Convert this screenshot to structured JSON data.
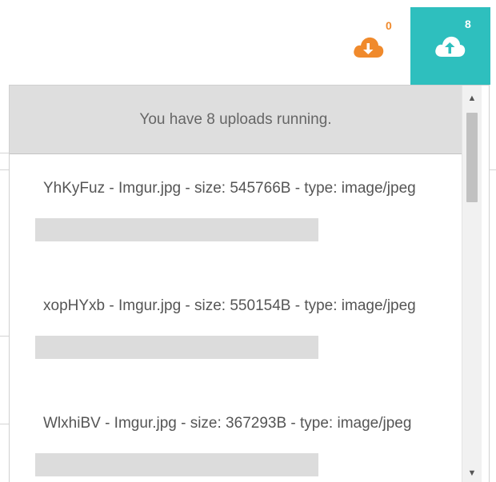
{
  "toolbar": {
    "download": {
      "icon": "cloud-download-icon",
      "count": "0",
      "color": "#f08a2c"
    },
    "upload": {
      "icon": "cloud-upload-icon",
      "count": "8",
      "color": "#2ebfbe"
    }
  },
  "uploads_panel": {
    "header": "You have 8 uploads running.",
    "items": [
      {
        "label": "YhKyFuz - Imgur.jpg - size: 545766B - type: image/jpeg",
        "progress": 0
      },
      {
        "label": "xopHYxb - Imgur.jpg - size: 550154B - type: image/jpeg",
        "progress": 0
      },
      {
        "label": "WlxhiBV - Imgur.jpg - size: 367293B - type: image/jpeg",
        "progress": 0
      }
    ]
  },
  "scrollbar": {
    "up_icon": "scroll-up-arrow-icon",
    "down_icon": "scroll-down-arrow-icon"
  }
}
